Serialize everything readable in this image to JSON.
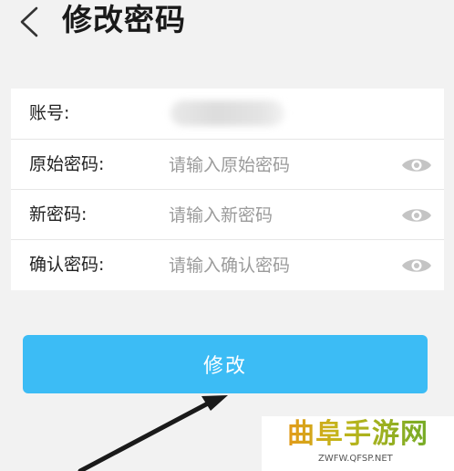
{
  "header": {
    "title": "修改密码"
  },
  "form": {
    "account": {
      "label": "账号:",
      "value": ""
    },
    "old_password": {
      "label": "原始密码:",
      "placeholder": "请输入原始密码"
    },
    "new_password": {
      "label": "新密码:",
      "placeholder": "请输入新密码"
    },
    "confirm_password": {
      "label": "确认密码:",
      "placeholder": "请输入确认密码"
    }
  },
  "submit": {
    "label": "修改"
  },
  "watermark": {
    "title": "曲阜手游网",
    "url": "ZWFW.QFSP.NET"
  },
  "colors": {
    "accent": "#3cbcf5",
    "background": "#f2f2f2",
    "card": "#ffffff",
    "placeholder": "#9b9b9b",
    "icon": "#c4c4c4"
  },
  "icons": {
    "back": "chevron-left-icon",
    "toggle_visibility": "eye-icon",
    "annotation": "arrow-icon"
  }
}
